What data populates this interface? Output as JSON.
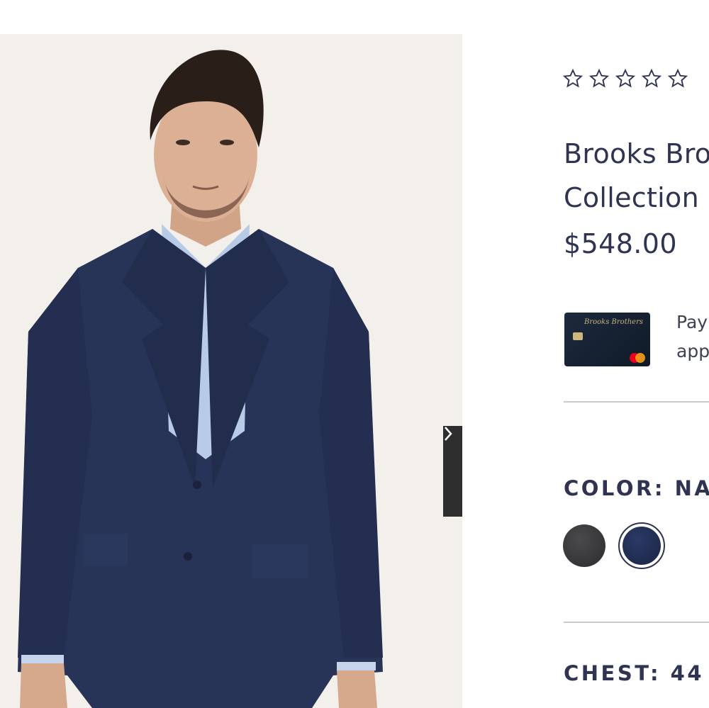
{
  "product": {
    "title_line1": "Brooks Bro",
    "title_line2": "Collection",
    "price": "$548.00",
    "rating": {
      "stars_total": 5,
      "stars_filled": 0
    }
  },
  "financing": {
    "card_brand": "Brooks Brothers",
    "text": "Pay\napp"
  },
  "color": {
    "label": "COLOR:",
    "selected": "NAV",
    "swatches": [
      {
        "name": "charcoal",
        "hex": "#323234"
      },
      {
        "name": "navy",
        "hex": "#1f2a4d",
        "selected": true
      }
    ]
  },
  "chest": {
    "label": "CHEST:",
    "value": "44"
  },
  "gallery": {
    "next_icon": "chevron-right-icon"
  },
  "colors": {
    "text": "#2f3452",
    "divider": "#c8c9d0",
    "carousel_button": "#2e2e2e"
  }
}
